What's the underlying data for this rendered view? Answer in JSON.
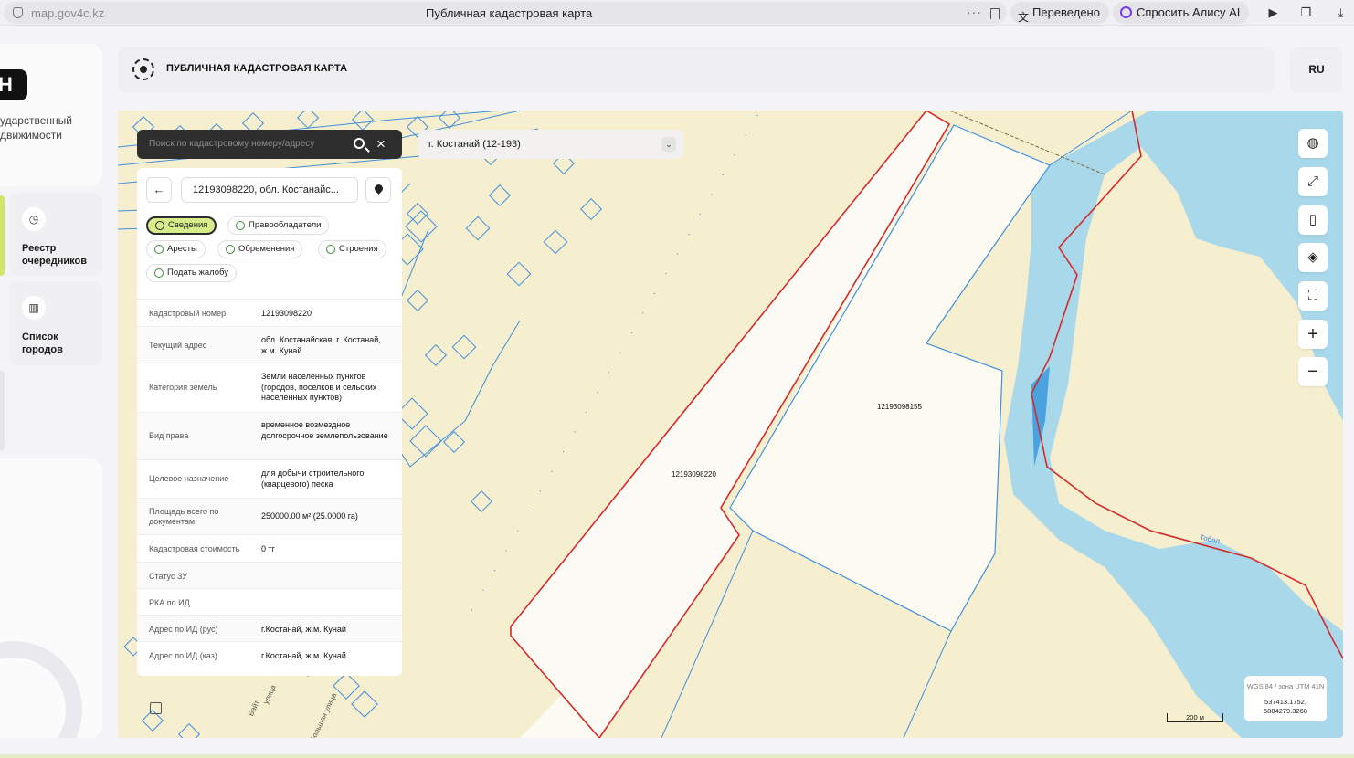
{
  "browser": {
    "url": "map.gov4c.kz",
    "tab_title": "Публичная кадастровая карта",
    "more": "···",
    "translated_label": "Переведено",
    "alice_label": "Спросить Алису AI"
  },
  "sidebar": {
    "logo_letter": "Н",
    "description": "ударственный\nдвижимости",
    "cards": [
      {
        "label": "Реестр\nочередников",
        "icon": "clock-icon"
      },
      {
        "label": "Список\nгородов",
        "icon": "building-icon"
      }
    ]
  },
  "header": {
    "title": "ПУБЛИЧНАЯ КАДАСТРОВАЯ КАРТА",
    "lang": "RU"
  },
  "search": {
    "placeholder": "Поиск по кадастровому номеру/адресу",
    "city": "г. Костанай (12-193)"
  },
  "panel": {
    "title": "12193098220, обл. Костанайс...",
    "tabs": [
      {
        "label": "Сведения",
        "active": true
      },
      {
        "label": "Правообладатели"
      },
      {
        "label": "Аресты"
      },
      {
        "label": "Обременения"
      },
      {
        "label": "Строения"
      },
      {
        "label": "Подать жалобу"
      }
    ],
    "rows": [
      {
        "key": "Кадастровый номер",
        "value": "12193098220"
      },
      {
        "key": "Текущий адрес",
        "value": "обл. Костанайская, г. Костанай, ж.м. Кунай"
      },
      {
        "key": "Категория земель",
        "value": "Земли населенных пунктов (городов, поселков и сельских населенных пунктов)"
      },
      {
        "key": "Вид права",
        "value": "временное возмездное долгосрочное землепользование"
      },
      {
        "key": "Целевое назначение",
        "value": "для добычи строительного (кварцевого) песка"
      },
      {
        "key": "Площадь всего по документам",
        "value": "250000.00 м² (25.0000 га)"
      },
      {
        "key": "Кадастровая стоимость",
        "value": "0 тг"
      },
      {
        "key": "Статус ЗУ",
        "value": ""
      },
      {
        "key": "РКА по ИД",
        "value": ""
      },
      {
        "key": "Адрес по ИД (рус)",
        "value": "г.Костанай, ж.м. Кунай"
      },
      {
        "key": "Адрес по ИД (каз)",
        "value": "г.Костанай, ж.м. Кунай"
      }
    ]
  },
  "map": {
    "plot_labels": [
      "12193098155",
      "12193098220"
    ],
    "street_labels": [
      "Байт",
      "улица",
      "Большая улица"
    ],
    "river_label": "Тобол",
    "scale": "200 м",
    "crs": "WGS 84 / зона UTM 41N",
    "coords": "537413.1752,\n5884279.3268"
  },
  "colors": {
    "accent": "#d7ec8a",
    "parcel_red": "#d42a2a",
    "parcel_blue": "#3f8fdc",
    "water": "#a8d8ea",
    "land": "#f5efcf"
  }
}
